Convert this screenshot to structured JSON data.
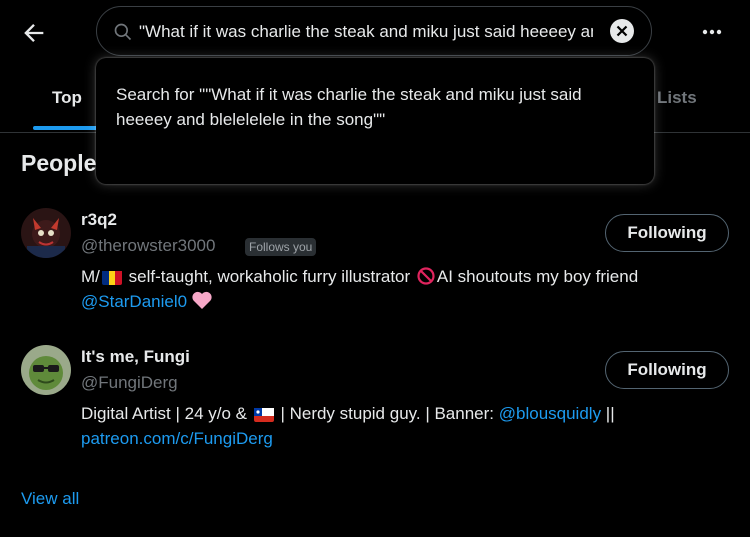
{
  "search": {
    "value": "\"What if it was charlie the steak and miku just said heeeey and blelelelele in the song\"",
    "suggestion_prefix": "Search for ",
    "suggestion_query": "\"\"What if it was charlie the steak and miku just said heeeey and blelelelele in the song\"\""
  },
  "tabs": [
    {
      "label": "Top",
      "active": true
    },
    {
      "label": "Lists",
      "active": false
    }
  ],
  "section_title": "People",
  "users": [
    {
      "name": "r3q2",
      "handle": "@therowster3000",
      "badge": "Follows you",
      "follow_label": "Following",
      "bio_part1": "M/",
      "flag": "romania-flag-icon",
      "bio_part2": " self-taught, workaholic furry illustrator ",
      "no_icon": "prohibited-icon",
      "bio_part3": "AI shoutouts my boy friend ",
      "bio_link": "@StarDaniel0",
      "heart": "pink-heart-icon"
    },
    {
      "name": "It's me, Fungi",
      "handle": "@FungiDerg",
      "follow_label": "Following",
      "bio_part1": "Digital Artist | 24 y/o & ",
      "flag": "chile-flag-icon",
      "bio_part2": " | Nerdy stupid guy. | Banner: ",
      "bio_link1": "@blousquidly",
      "bio_part3": " ||",
      "bio_link2": "patreon.com/c/FungiDerg"
    }
  ],
  "view_all": "View all",
  "colors": {
    "accent": "#1d9bf0",
    "text": "#e7e9ea",
    "muted": "#71767b",
    "background": "#000000"
  }
}
